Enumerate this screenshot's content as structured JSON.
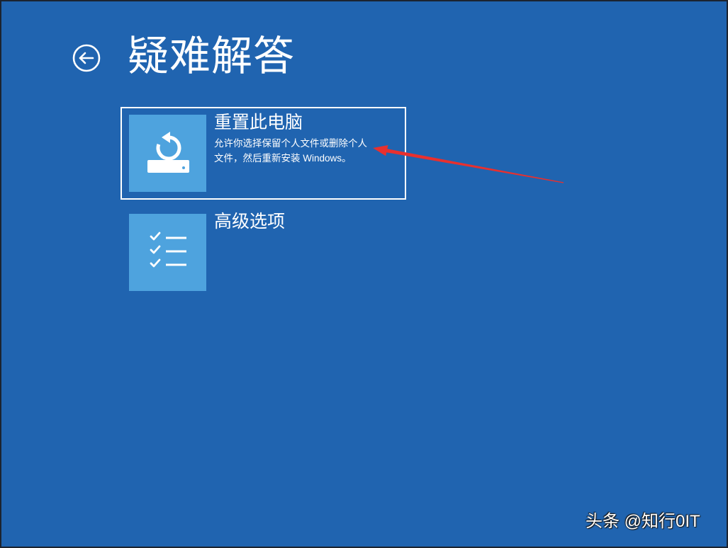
{
  "page": {
    "title": "疑难解答"
  },
  "back_button": {
    "icon": "back-arrow-icon"
  },
  "options": [
    {
      "title": "重置此电脑",
      "description_lines": [
        "允许你选择保留个人文件或删除个人",
        "文件，然后重新安装 Windows。"
      ],
      "icon": "reset-pc-icon",
      "selected": true
    },
    {
      "title": "高级选项",
      "icon": "checklist-icon",
      "selected": false
    }
  ],
  "watermark": "头条 @知行0IT",
  "colors": {
    "background": "#2064b0",
    "tile": "#4ea3de",
    "text": "#ffffff",
    "annotation_arrow": "#e8302e"
  }
}
